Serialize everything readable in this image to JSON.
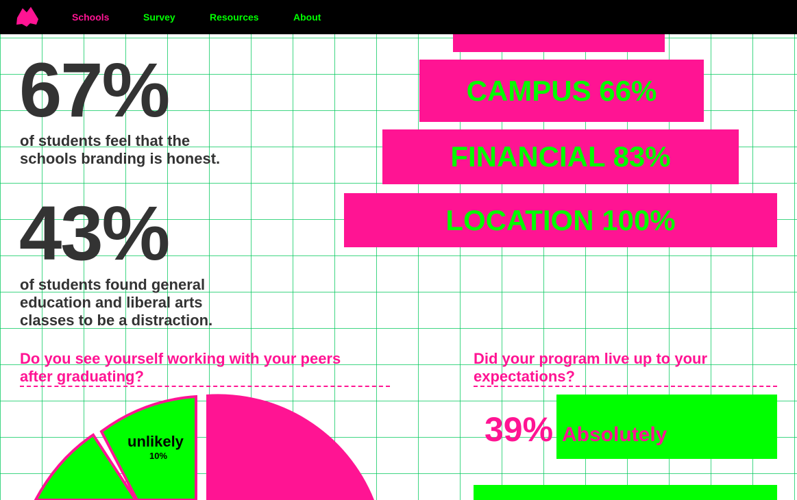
{
  "nav": {
    "items": [
      {
        "label": "Schools",
        "color": "#ff1493"
      },
      {
        "label": "Survey",
        "color": "#00ff00"
      },
      {
        "label": "Resources",
        "color": "#00ff00"
      },
      {
        "label": "About",
        "color": "#00ff00"
      }
    ],
    "logo_icon": "mountain-logo-icon"
  },
  "stats": [
    {
      "value": "67%",
      "line1": "of students feel that the",
      "line2": "schools branding is honest."
    },
    {
      "value": "43%",
      "line1": "of students found general",
      "line2": "education and liberal arts",
      "line3": "classes to be a distraction."
    }
  ],
  "bars": [
    {
      "label": "CAMPUS 66%"
    },
    {
      "label": "FINANCIAL 83%"
    },
    {
      "label": "LOCATION 100%"
    }
  ],
  "question1": {
    "line1": "Do you see yourself working with your peers",
    "line2": "after graduating?",
    "slice_label": "unlikely",
    "slice_pct": "10%"
  },
  "question2": {
    "line1": "Did your program live up to your",
    "line2": "expectations?",
    "answer_pct": "39%",
    "answer_label": "Absolutely"
  },
  "colors": {
    "accent_pink": "#ff1493",
    "accent_green": "#00ff00",
    "text_dark": "#333333"
  }
}
